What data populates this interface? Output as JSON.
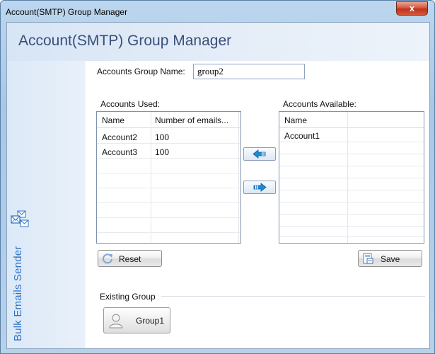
{
  "window": {
    "title": "Account(SMTP) Group Manager",
    "close_glyph": "x"
  },
  "header": {
    "title": "Account(SMTP) Group Manager"
  },
  "sidebar": {
    "brand_text": "Bulk Emails Sender",
    "brand_icon": "envelopes-icon"
  },
  "form": {
    "group_name_label": "Accounts Group Name:",
    "group_name_value": "group2"
  },
  "accounts_used": {
    "label": "Accounts Used:",
    "columns": [
      "Name",
      "Number of emails..."
    ],
    "rows": [
      [
        "Account2",
        "100"
      ],
      [
        "Account3",
        "100"
      ]
    ]
  },
  "accounts_available": {
    "label": "Accounts Available:",
    "columns": [
      "Name",
      ""
    ],
    "rows": [
      [
        "Account1",
        ""
      ]
    ]
  },
  "buttons": {
    "move_left_icon": "arrow-left-icon",
    "move_right_icon": "arrow-right-icon",
    "reset_label": "Reset",
    "save_label": "Save"
  },
  "existing_group": {
    "label": "Existing Group",
    "groups": [
      "Group1"
    ]
  },
  "colors": {
    "brand_blue": "#2f73c8",
    "header_text": "#3a4f7a",
    "close_red": "#c0301a",
    "arrow_blue": "#1f8ad6"
  }
}
